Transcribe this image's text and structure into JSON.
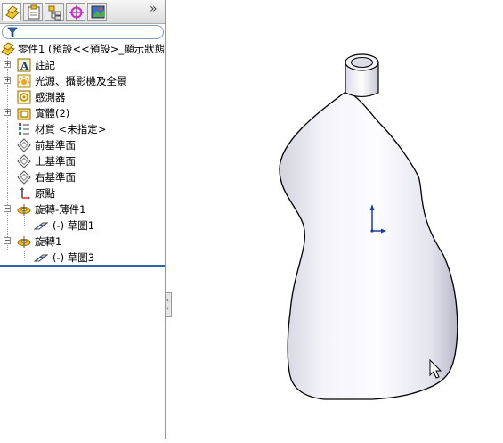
{
  "tabs": [
    {
      "name": "featuremanager",
      "icon": "feature-tree-icon",
      "active": true
    },
    {
      "name": "propertymanager",
      "icon": "property-manager-icon",
      "active": false
    },
    {
      "name": "configurationmanager",
      "icon": "configuration-manager-icon",
      "active": false
    },
    {
      "name": "dimxpert",
      "icon": "dimxpert-icon",
      "active": false
    },
    {
      "name": "display-manager",
      "icon": "display-manager-icon",
      "active": false
    }
  ],
  "more_tabs_label": "»",
  "tree": {
    "root": "零件1  (預設<<預設>_顯示狀態",
    "annotations": "註記",
    "lights": "光源、攝影機及全景",
    "sensors": "感測器",
    "solid_bodies": "實體(2)",
    "material": "材質 <未指定>",
    "front_plane": "前基準面",
    "top_plane": "上基準面",
    "right_plane": "右基準面",
    "origin": "原點",
    "revolve_thin": "旋轉-薄件1",
    "sketch1": "(-) 草圖1",
    "revolve1": "旋轉1",
    "sketch3": "(-) 草圖3"
  },
  "colors": {
    "accent": "#2f64b3",
    "panel_border": "#7f9db9",
    "model_light": "#f7f7fb",
    "model_dark": "#c9c9d6"
  }
}
